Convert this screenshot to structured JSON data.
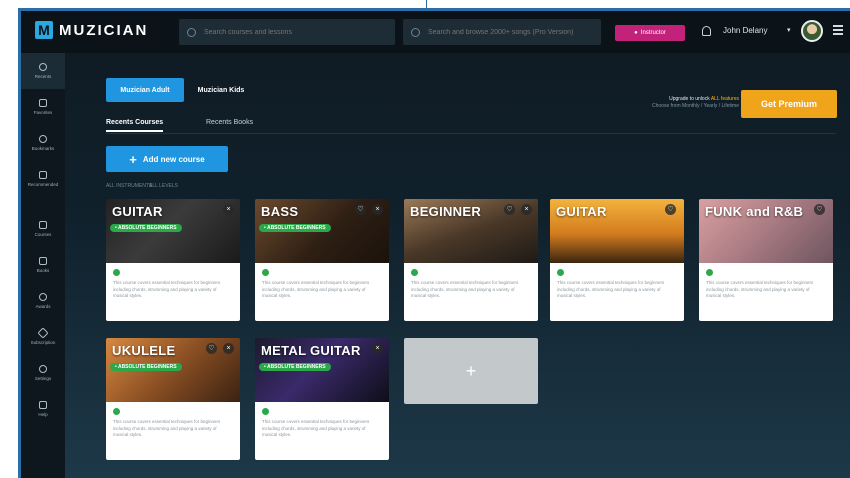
{
  "app": {
    "logo_mark": "M",
    "logo_text": "MUZICIAN"
  },
  "search": {
    "placeholder_1": "Search courses and lessons",
    "placeholder_2": "Search and browse 2000+ songs (Pro Version)"
  },
  "header": {
    "instructor_label": "Instructor",
    "user_name": "John Delany",
    "caret": "▾"
  },
  "sidebar": {
    "items": [
      {
        "label": "Recents"
      },
      {
        "label": "Favorites"
      },
      {
        "label": "Bookmarks"
      },
      {
        "label": "Recommended"
      },
      {
        "label": "Courses"
      },
      {
        "label": "Books"
      },
      {
        "label": "Awards"
      },
      {
        "label": "Subscription"
      },
      {
        "label": "Settings"
      },
      {
        "label": "Help"
      }
    ]
  },
  "tabs": {
    "adult": "Muzician Adult",
    "kids": "Muzician Kids"
  },
  "upgrade": {
    "line1_prefix": "Upgrade to unlock",
    "line1_highlight": "ALL features",
    "line2": "Choose from Monthly / Yearly / Lifetime",
    "button": "Get Premium"
  },
  "subtabs": {
    "courses": "Recents Courses",
    "books": "Recents Books"
  },
  "add_course": {
    "plus": "+",
    "label": "Add new course"
  },
  "filters": {
    "f1": "ALL INSTRUMENTS",
    "f2": "ALL LEVELS"
  },
  "colors": {
    "accent": "#2196e0",
    "premium": "#f0a41a",
    "badge": "#2aa84a",
    "instructor": "#c2227a"
  },
  "courses": [
    {
      "title": "GUITAR",
      "badge": "• ABSOLUTE BEGINNERS",
      "desc": "This course covers essential techniques for beginners including chords, strumming and playing a variety of musical styles."
    },
    {
      "title": "BASS",
      "badge": "• ABSOLUTE BEGINNERS",
      "desc": "This course covers essential techniques for beginners including chords, strumming and playing a variety of musical styles."
    },
    {
      "title": "BEGINNER",
      "badge": "",
      "desc": "This course covers essential techniques for beginners including chords, strumming and playing a variety of musical styles."
    },
    {
      "title": "GUITAR",
      "badge": "",
      "desc": "This course covers essential techniques for beginners including chords, strumming and playing a variety of musical styles."
    },
    {
      "title": "FUNK and R&B",
      "badge": "",
      "desc": "This course covers essential techniques for beginners including chords, strumming and playing a variety of musical styles."
    },
    {
      "title": "UKULELE",
      "badge": "• ABSOLUTE BEGINNERS",
      "desc": "This course covers essential techniques for beginners including chords, strumming and playing a variety of musical styles."
    },
    {
      "title": "METAL GUITAR",
      "badge": "• ABSOLUTE BEGINNERS",
      "desc": "This course covers essential techniques for beginners including chords, strumming and playing a variety of musical styles."
    }
  ],
  "add_card": {
    "plus": "+"
  }
}
